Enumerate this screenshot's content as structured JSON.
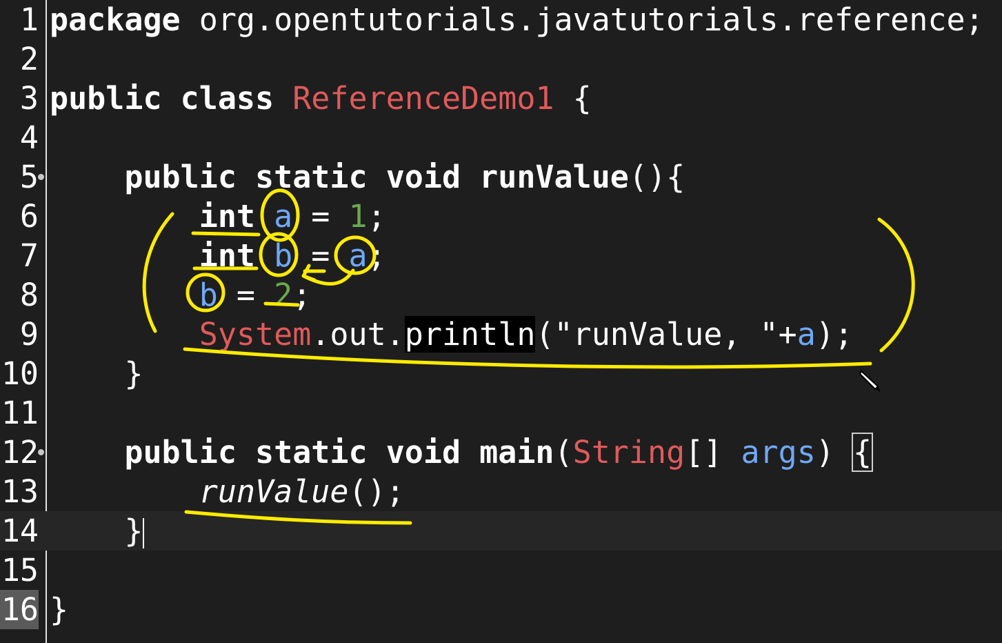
{
  "editor": {
    "lines": [
      {
        "n": "1",
        "tokens": [
          {
            "t": "package",
            "c": "kw"
          },
          {
            "t": " org.opentutorials.javatutorials.reference;",
            "c": "plain"
          }
        ]
      },
      {
        "n": "2",
        "tokens": []
      },
      {
        "n": "3",
        "tokens": [
          {
            "t": "public",
            "c": "kw"
          },
          {
            "t": " ",
            "c": "plain"
          },
          {
            "t": "class",
            "c": "kw"
          },
          {
            "t": " ",
            "c": "plain"
          },
          {
            "t": "ReferenceDemo1",
            "c": "cls"
          },
          {
            "t": " {",
            "c": "plain"
          }
        ]
      },
      {
        "n": "4",
        "tokens": []
      },
      {
        "n": "5",
        "fold": true,
        "tokens": [
          {
            "t": "    ",
            "c": "plain"
          },
          {
            "t": "public",
            "c": "kw"
          },
          {
            "t": " ",
            "c": "plain"
          },
          {
            "t": "static",
            "c": "kw"
          },
          {
            "t": " ",
            "c": "plain"
          },
          {
            "t": "void",
            "c": "kw"
          },
          {
            "t": " ",
            "c": "plain"
          },
          {
            "t": "runValue",
            "c": "kw"
          },
          {
            "t": "(){",
            "c": "plain"
          }
        ]
      },
      {
        "n": "6",
        "tokens": [
          {
            "t": "        ",
            "c": "plain"
          },
          {
            "t": "int",
            "c": "kw"
          },
          {
            "t": " ",
            "c": "plain"
          },
          {
            "t": "a",
            "c": "var"
          },
          {
            "t": " = ",
            "c": "plain"
          },
          {
            "t": "1",
            "c": "num"
          },
          {
            "t": ";",
            "c": "plain"
          }
        ]
      },
      {
        "n": "7",
        "tokens": [
          {
            "t": "        ",
            "c": "plain"
          },
          {
            "t": "int",
            "c": "kw"
          },
          {
            "t": " ",
            "c": "plain"
          },
          {
            "t": "b",
            "c": "var"
          },
          {
            "t": " = ",
            "c": "plain"
          },
          {
            "t": "a",
            "c": "var"
          },
          {
            "t": ";",
            "c": "plain"
          }
        ]
      },
      {
        "n": "8",
        "tokens": [
          {
            "t": "        ",
            "c": "plain"
          },
          {
            "t": "b",
            "c": "var"
          },
          {
            "t": " = ",
            "c": "plain"
          },
          {
            "t": "2",
            "c": "num"
          },
          {
            "t": ";",
            "c": "plain"
          }
        ]
      },
      {
        "n": "9",
        "tokens": [
          {
            "t": "        ",
            "c": "plain"
          },
          {
            "t": "System",
            "c": "cls"
          },
          {
            "t": ".out.",
            "c": "plain"
          },
          {
            "t": "println",
            "c": "hl"
          },
          {
            "t": "(\"runValue, \"+",
            "c": "plain"
          },
          {
            "t": "a",
            "c": "var"
          },
          {
            "t": ");",
            "c": "plain"
          }
        ]
      },
      {
        "n": "10",
        "tokens": [
          {
            "t": "    }",
            "c": "plain"
          }
        ]
      },
      {
        "n": "11",
        "tokens": []
      },
      {
        "n": "12",
        "fold": true,
        "tokens": [
          {
            "t": "    ",
            "c": "plain"
          },
          {
            "t": "public",
            "c": "kw"
          },
          {
            "t": " ",
            "c": "plain"
          },
          {
            "t": "static",
            "c": "kw"
          },
          {
            "t": " ",
            "c": "plain"
          },
          {
            "t": "void",
            "c": "kw"
          },
          {
            "t": " ",
            "c": "plain"
          },
          {
            "t": "main",
            "c": "kw"
          },
          {
            "t": "(",
            "c": "plain"
          },
          {
            "t": "String",
            "c": "cls"
          },
          {
            "t": "[] ",
            "c": "plain"
          },
          {
            "t": "args",
            "c": "var"
          },
          {
            "t": ") ",
            "c": "plain"
          },
          {
            "t": "{",
            "c": "box"
          }
        ]
      },
      {
        "n": "13",
        "tokens": [
          {
            "t": "        ",
            "c": "plain"
          },
          {
            "t": "runValue",
            "c": "ital"
          },
          {
            "t": "();",
            "c": "plain"
          }
        ]
      },
      {
        "n": "14",
        "current": true,
        "tokens": [
          {
            "t": "    }",
            "c": "plain"
          },
          {
            "t": "",
            "c": "caret"
          }
        ]
      },
      {
        "n": "15",
        "tokens": []
      },
      {
        "n": "16",
        "selected": true,
        "tokens": [
          {
            "t": "}",
            "c": "plain"
          }
        ]
      }
    ]
  },
  "colors": {
    "background": "#1e1e1e",
    "annotation": "#ffeb00",
    "class_name": "#e05a5a",
    "number": "#6aa84f",
    "variable": "#6fa8f5"
  },
  "icons": {
    "cursor": "pen-cursor-icon"
  }
}
